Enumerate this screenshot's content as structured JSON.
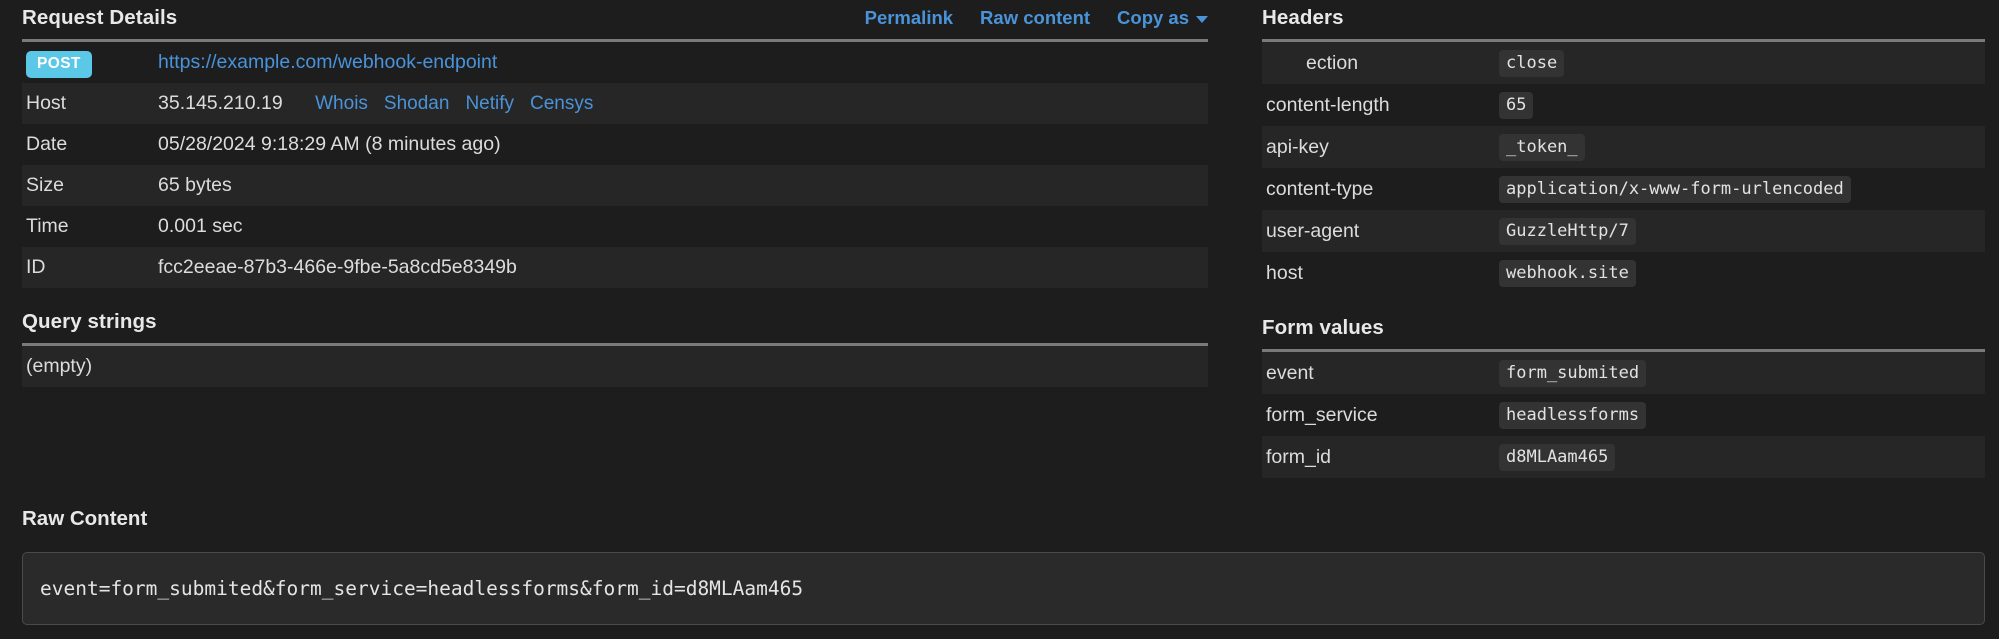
{
  "left": {
    "title": "Request Details",
    "actions": [
      {
        "label": "Permalink",
        "name": "permalink-link"
      },
      {
        "label": "Raw content",
        "name": "raw-content-link"
      },
      {
        "label": "Copy as",
        "name": "copy-as-dropdown"
      }
    ],
    "method_badge": "POST",
    "url": "https://example.com/webhook-endpoint",
    "rows": [
      {
        "key": "Host",
        "value": "35.145.210.19"
      },
      {
        "key": "Date",
        "value": "05/28/2024 9:18:29 AM (8 minutes ago)"
      },
      {
        "key": "Size",
        "value": "65 bytes"
      },
      {
        "key": "Time",
        "value": "0.001 sec"
      },
      {
        "key": "ID",
        "value": "fcc2eeae-87b3-466e-9fbe-5a8cd5e8349b"
      }
    ],
    "host_links": [
      "Whois",
      "Shodan",
      "Netify",
      "Censys"
    ],
    "query_strings": {
      "title": "Query strings",
      "empty_label": "(empty)"
    }
  },
  "right": {
    "headers": {
      "title": "Headers",
      "rows": [
        {
          "key": "ection",
          "value": "close",
          "indented": true
        },
        {
          "key": "content-length",
          "value": "65"
        },
        {
          "key": "api-key",
          "value": "_token_"
        },
        {
          "key": "content-type",
          "value": "application/x-www-form-urlencoded"
        },
        {
          "key": "user-agent",
          "value": "GuzzleHttp/7"
        },
        {
          "key": "host",
          "value": "webhook.site"
        }
      ]
    },
    "form_values": {
      "title": "Form values",
      "rows": [
        {
          "key": "event",
          "value": "form_submited"
        },
        {
          "key": "form_service",
          "value": "headlessforms"
        },
        {
          "key": "form_id",
          "value": "d8MLAam465"
        }
      ]
    }
  },
  "raw": {
    "title": "Raw Content",
    "body": "event=form_submited&form_service=headlessforms&form_id=d8MLAam465"
  },
  "colors": {
    "background": "#1d1d1d",
    "stripe": "#262626",
    "link": "#4a93d9",
    "badge_post": "#5bc8e8",
    "mono_chip": "#333333",
    "rule": "#7a7a7a"
  }
}
